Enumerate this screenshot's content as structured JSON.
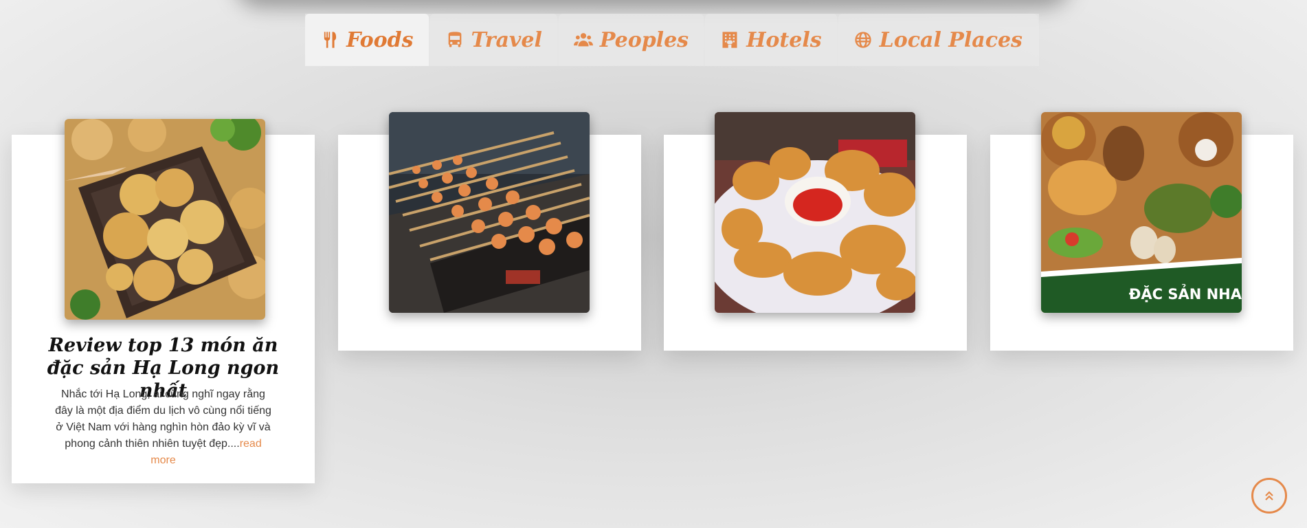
{
  "tabs": [
    {
      "label": "Foods",
      "icon": "utensils-icon",
      "active": true
    },
    {
      "label": "Travel",
      "icon": "bus-icon"
    },
    {
      "label": "Peoples",
      "icon": "users-icon"
    },
    {
      "label": "Hotels",
      "icon": "hotel-icon"
    },
    {
      "label": "Local Places",
      "icon": "globe-icon"
    }
  ],
  "cards": [
    {
      "title": "Review top 13 món ăn đặc sản Hạ Long ngon nhất",
      "excerpt": "Nhắc tới Hạ Long, ai cũng nghĩ ngay rằng đây là một địa điểm du lịch vô cùng nổi tiếng ở Việt Nam với hàng nghìn hòn đảo kỳ vĩ và phong cảnh thiên nhiên tuyệt đẹp....",
      "read_more": "read more",
      "image": "fried-squid-cakes-photo"
    },
    {
      "image": "grilled-skewers-photo"
    },
    {
      "image": "fried-dumplings-photo"
    },
    {
      "image": "specialty-food-banner-photo",
      "banner_text": "ĐẶC SẢN NHA"
    }
  ],
  "scroll_top": {
    "icon": "double-chevron-up-icon"
  },
  "colors": {
    "accent": "#e5894a",
    "banner_green": "#1f5a25"
  }
}
